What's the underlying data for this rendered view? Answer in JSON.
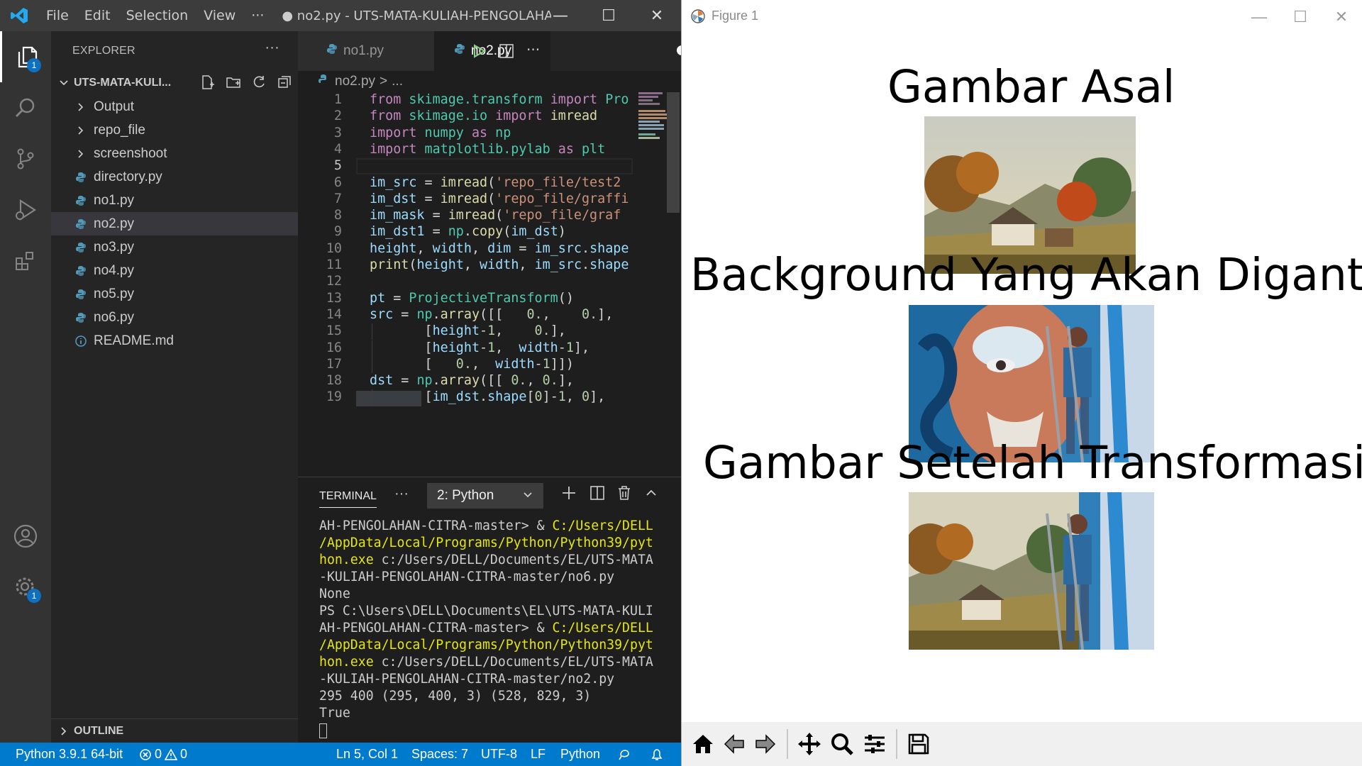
{
  "vscode": {
    "menu": [
      "File",
      "Edit",
      "Selection",
      "View"
    ],
    "menu_more": "···",
    "window_title": "● no2.py - UTS-MATA-KULIAH-PENGOLAHA...",
    "window_controls": {
      "minimize": "—",
      "maximize": "☐",
      "close": "✕"
    },
    "activity_badges": {
      "explorer": "1",
      "settings": "1"
    },
    "sidebar": {
      "title": "EXPLORER",
      "more": "···",
      "folder": "UTS-MATA-KULI...",
      "items": [
        {
          "label": "Output",
          "kind": "folder"
        },
        {
          "label": "repo_file",
          "kind": "folder"
        },
        {
          "label": "screenshoot",
          "kind": "folder"
        },
        {
          "label": "directory.py",
          "kind": "python"
        },
        {
          "label": "no1.py",
          "kind": "python"
        },
        {
          "label": "no2.py",
          "kind": "python",
          "selected": true
        },
        {
          "label": "no3.py",
          "kind": "python"
        },
        {
          "label": "no4.py",
          "kind": "python"
        },
        {
          "label": "no5.py",
          "kind": "python"
        },
        {
          "label": "no6.py",
          "kind": "python"
        },
        {
          "label": "README.md",
          "kind": "info"
        }
      ],
      "outline": "OUTLINE"
    },
    "tabs": [
      {
        "label": "no1.py",
        "active": false
      },
      {
        "label": "no2.py",
        "active": true,
        "dirty": true
      }
    ],
    "tab_more": "···",
    "breadcrumb": {
      "file": "no2.py",
      "sep": ">",
      "more": "..."
    },
    "current_line": 5,
    "code_lines": [
      {
        "n": "1",
        "parts": [
          [
            "kw",
            "from "
          ],
          [
            "cls",
            "skimage.transform "
          ],
          [
            "kw",
            "import "
          ],
          [
            "cls",
            "Pro"
          ]
        ]
      },
      {
        "n": "2",
        "parts": [
          [
            "kw",
            "from "
          ],
          [
            "cls",
            "skimage.io "
          ],
          [
            "kw",
            "import "
          ],
          [
            "fn",
            "imread"
          ]
        ]
      },
      {
        "n": "3",
        "parts": [
          [
            "kw",
            "import "
          ],
          [
            "cls",
            "numpy "
          ],
          [
            "kw",
            "as "
          ],
          [
            "cls",
            "np"
          ]
        ]
      },
      {
        "n": "4",
        "parts": [
          [
            "kw",
            "import "
          ],
          [
            "cls",
            "matplotlib.pylab "
          ],
          [
            "kw",
            "as "
          ],
          [
            "cls",
            "plt"
          ]
        ]
      },
      {
        "n": "5",
        "parts": []
      },
      {
        "n": "6",
        "parts": [
          [
            "var",
            "im_src"
          ],
          [
            "",
            " = "
          ],
          [
            "fn",
            "imread"
          ],
          [
            "",
            "("
          ],
          [
            "str",
            "'repo_file/test2"
          ]
        ]
      },
      {
        "n": "7",
        "parts": [
          [
            "var",
            "im_dst"
          ],
          [
            "",
            " = "
          ],
          [
            "fn",
            "imread"
          ],
          [
            "",
            "("
          ],
          [
            "str",
            "'repo_file/graffi"
          ]
        ]
      },
      {
        "n": "8",
        "parts": [
          [
            "var",
            "im_mask"
          ],
          [
            "",
            " = "
          ],
          [
            "fn",
            "imread"
          ],
          [
            "",
            "("
          ],
          [
            "str",
            "'repo_file/graf"
          ]
        ]
      },
      {
        "n": "9",
        "parts": [
          [
            "var",
            "im_dst1"
          ],
          [
            "",
            " = "
          ],
          [
            "cls",
            "np"
          ],
          [
            "",
            "."
          ],
          [
            "fn",
            "copy"
          ],
          [
            "",
            "("
          ],
          [
            "var",
            "im_dst"
          ],
          [
            "",
            ")"
          ]
        ]
      },
      {
        "n": "10",
        "parts": [
          [
            "var",
            "height"
          ],
          [
            "",
            ", "
          ],
          [
            "var",
            "width"
          ],
          [
            "",
            ", "
          ],
          [
            "var",
            "dim"
          ],
          [
            "",
            " = "
          ],
          [
            "var",
            "im_src"
          ],
          [
            "",
            "."
          ],
          [
            "var",
            "shape"
          ]
        ]
      },
      {
        "n": "11",
        "parts": [
          [
            "fn",
            "print"
          ],
          [
            "",
            "("
          ],
          [
            "var",
            "height"
          ],
          [
            "",
            ", "
          ],
          [
            "var",
            "width"
          ],
          [
            "",
            ", "
          ],
          [
            "var",
            "im_src"
          ],
          [
            "",
            "."
          ],
          [
            "var",
            "shape"
          ]
        ]
      },
      {
        "n": "12",
        "parts": []
      },
      {
        "n": "13",
        "parts": [
          [
            "var",
            "pt"
          ],
          [
            "",
            " = "
          ],
          [
            "cls",
            "ProjectiveTransform"
          ],
          [
            "",
            "()"
          ]
        ]
      },
      {
        "n": "14",
        "parts": [
          [
            "var",
            "src"
          ],
          [
            "",
            " = "
          ],
          [
            "cls",
            "np"
          ],
          [
            "",
            "."
          ],
          [
            "fn",
            "array"
          ],
          [
            "",
            "([[   "
          ],
          [
            "num",
            "0."
          ],
          [
            "",
            ",    "
          ],
          [
            "num",
            "0."
          ],
          [
            "",
            "],"
          ]
        ]
      },
      {
        "n": "15",
        "parts": [
          [
            "",
            "       ["
          ],
          [
            "var",
            "height"
          ],
          [
            "",
            "-"
          ],
          [
            "num",
            "1"
          ],
          [
            "",
            ",    "
          ],
          [
            "num",
            "0."
          ],
          [
            "",
            "],"
          ]
        ]
      },
      {
        "n": "16",
        "parts": [
          [
            "",
            "       ["
          ],
          [
            "var",
            "height"
          ],
          [
            "",
            "-"
          ],
          [
            "num",
            "1"
          ],
          [
            "",
            ",  "
          ],
          [
            "var",
            "width"
          ],
          [
            "",
            "-"
          ],
          [
            "num",
            "1"
          ],
          [
            "",
            "],"
          ]
        ]
      },
      {
        "n": "17",
        "parts": [
          [
            "",
            "       [   "
          ],
          [
            "num",
            "0."
          ],
          [
            "",
            ",  "
          ],
          [
            "var",
            "width"
          ],
          [
            "",
            "-"
          ],
          [
            "num",
            "1"
          ],
          [
            "",
            "]])"
          ]
        ]
      },
      {
        "n": "18",
        "parts": [
          [
            "var",
            "dst"
          ],
          [
            "",
            " = "
          ],
          [
            "cls",
            "np"
          ],
          [
            "",
            "."
          ],
          [
            "fn",
            "array"
          ],
          [
            "",
            "([[ "
          ],
          [
            "num",
            "0."
          ],
          [
            "",
            ", "
          ],
          [
            "num",
            "0."
          ],
          [
            "",
            "],"
          ]
        ]
      },
      {
        "n": "19",
        "parts": [
          [
            "",
            "       ["
          ],
          [
            "var",
            "im_dst"
          ],
          [
            "",
            "."
          ],
          [
            "var",
            "shape"
          ],
          [
            "",
            "["
          ],
          [
            "num",
            "0"
          ],
          [
            "",
            "]-"
          ],
          [
            "num",
            "1"
          ],
          [
            "",
            ", "
          ],
          [
            "num",
            "0"
          ],
          [
            "",
            "],"
          ]
        ]
      }
    ],
    "panel": {
      "title": "TERMINAL",
      "more": "···",
      "selector": "2: Python",
      "lines": [
        [
          [
            "",
            "AH-PENGOLAHAN-CITRA-master> & "
          ],
          [
            "yl",
            "C:/Users/DELL"
          ]
        ],
        [
          [
            "yl",
            "/AppData/Local/Programs/Python/Python39/pyt"
          ]
        ],
        [
          [
            "yl",
            "hon.exe"
          ],
          [
            "",
            " c:/Users/DELL/Documents/EL/UTS-MATA"
          ]
        ],
        [
          [
            "",
            "-KULIAH-PENGOLAHAN-CITRA-master/no6.py"
          ]
        ],
        [
          [
            "",
            "None"
          ]
        ],
        [
          [
            "",
            "PS C:\\Users\\DELL\\Documents\\EL\\UTS-MATA-KULI"
          ]
        ],
        [
          [
            "",
            "AH-PENGOLAHAN-CITRA-master> & "
          ],
          [
            "yl",
            "C:/Users/DELL"
          ]
        ],
        [
          [
            "yl",
            "/AppData/Local/Programs/Python/Python39/pyt"
          ]
        ],
        [
          [
            "yl",
            "hon.exe"
          ],
          [
            "",
            " c:/Users/DELL/Documents/EL/UTS-MATA"
          ]
        ],
        [
          [
            "",
            "-KULIAH-PENGOLAHAN-CITRA-master/no2.py"
          ]
        ],
        [
          [
            "",
            "295 400 (295, 400, 3) (528, 829, 3)"
          ]
        ],
        [
          [
            "",
            "True"
          ]
        ]
      ]
    },
    "status": {
      "python": "Python 3.9.1 64-bit",
      "errors": "0",
      "warnings": "0",
      "position": "Ln 5, Col 1",
      "spaces": "Spaces: 7",
      "encoding": "UTF-8",
      "eol": "LF",
      "language": "Python"
    },
    "colors": {
      "accent": "#007acc",
      "title_bar": "#3c3c3c",
      "sidebar": "#252526",
      "editor": "#1e1e1e"
    }
  },
  "figure": {
    "title": "Figure 1",
    "window_controls": {
      "minimize": "—",
      "maximize": "☐",
      "close": "✕"
    },
    "subplots": [
      {
        "title": "Gambar Asal",
        "image": "autumn farm landscape painting"
      },
      {
        "title": "Background Yang Akan Digant",
        "image": "graffiti mural with man on ladder"
      },
      {
        "title": "Gambar Setelah Transformasi",
        "image": "mural with landscape painting warped in"
      }
    ],
    "toolbar": [
      "home-icon",
      "back-arrow-icon",
      "forward-arrow-icon",
      "pan-icon",
      "zoom-icon",
      "configure-subplots-icon",
      "save-icon"
    ]
  }
}
